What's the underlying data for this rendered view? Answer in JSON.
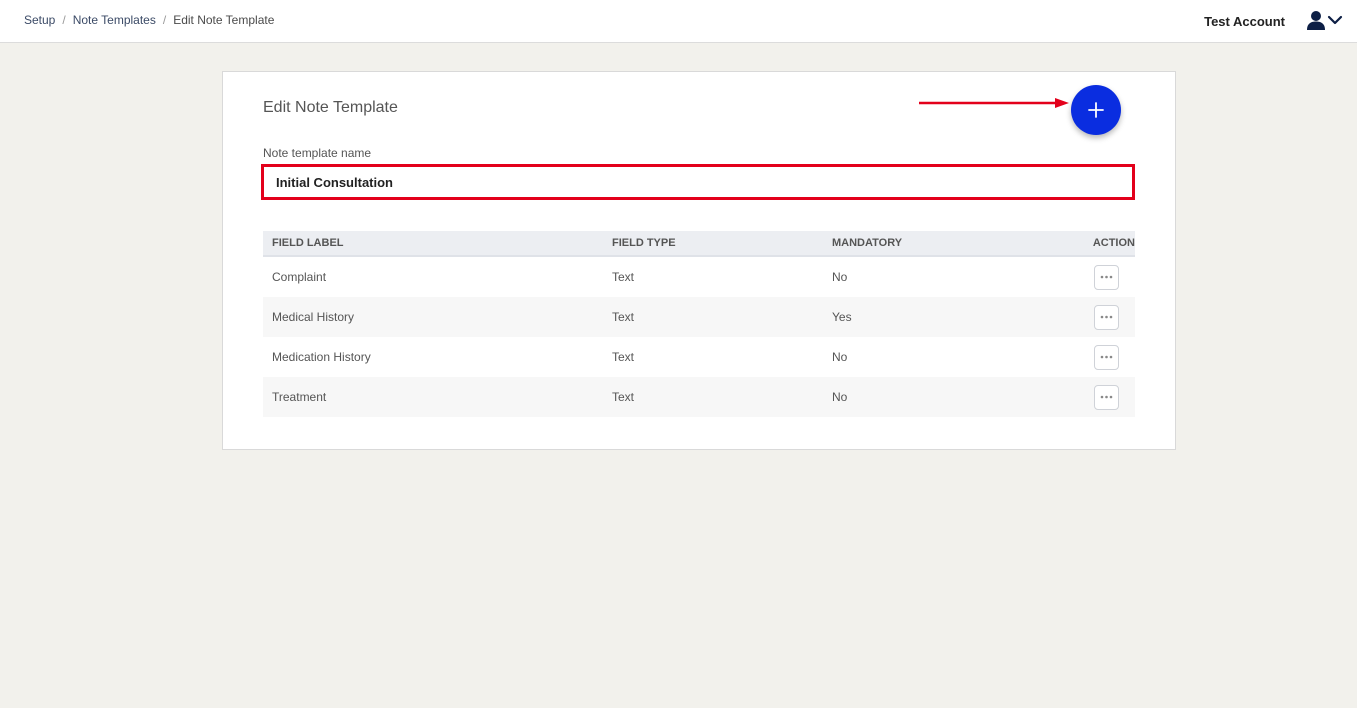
{
  "breadcrumb": {
    "items": [
      "Setup",
      "Note Templates"
    ],
    "current": "Edit Note Template",
    "separator": "/"
  },
  "header": {
    "account_name": "Test Account"
  },
  "card": {
    "title": "Edit Note Template",
    "name_label": "Note template name",
    "name_value": "Initial Consultation"
  },
  "table": {
    "headers": [
      "FIELD LABEL",
      "FIELD TYPE",
      "MANDATORY",
      "ACTION"
    ],
    "rows": [
      {
        "label": "Complaint",
        "type": "Text",
        "mandatory": "No"
      },
      {
        "label": "Medical History",
        "type": "Text",
        "mandatory": "Yes"
      },
      {
        "label": "Medication History",
        "type": "Text",
        "mandatory": "No"
      },
      {
        "label": "Treatment",
        "type": "Text",
        "mandatory": "No"
      }
    ]
  },
  "icons": {
    "add": "plus-icon",
    "user": "user-icon",
    "menu": "chevron-down-icon",
    "row_action": "more-horizontal-icon"
  },
  "colors": {
    "accent": "#0a2de0",
    "annotation": "#e3001b",
    "nav_text": "#3b4a66"
  }
}
